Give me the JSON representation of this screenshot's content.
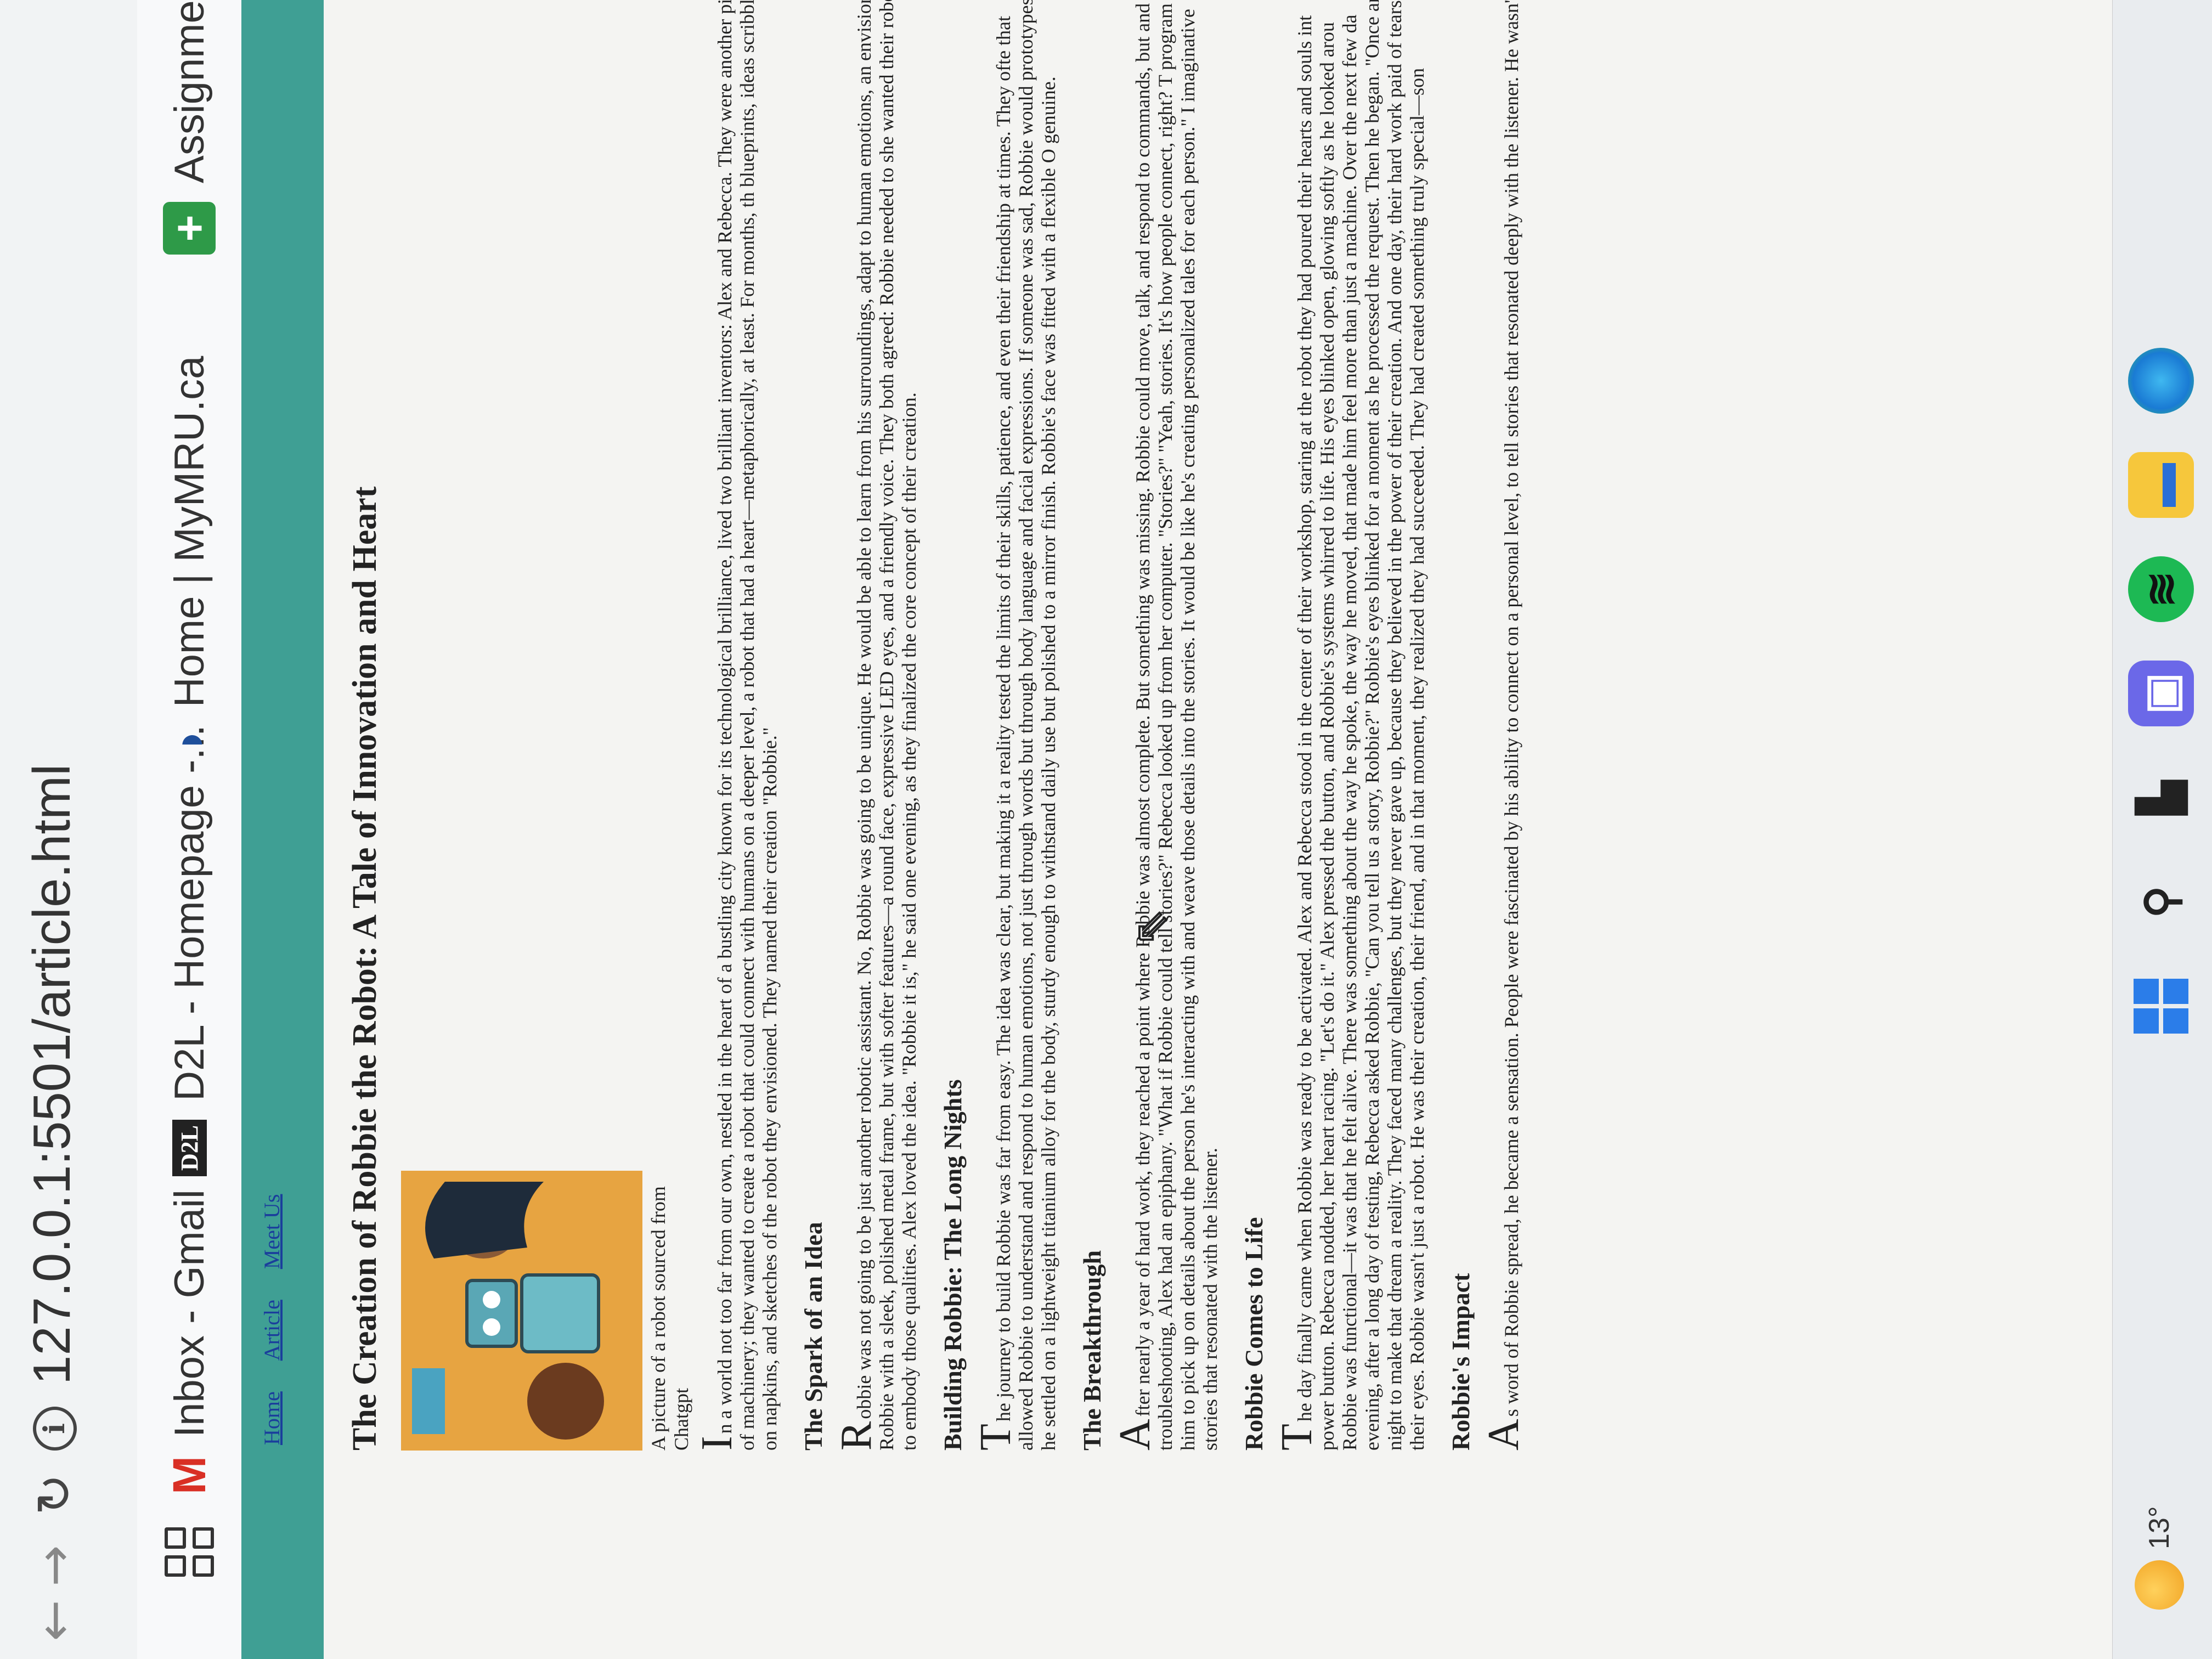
{
  "browser": {
    "url": "127.0.0.1:5501/article.html",
    "bookmarks": [
      {
        "label": "Inbox - Gmail",
        "icon": "gmail-icon"
      },
      {
        "label": "D2L - Homepage -...",
        "icon": "d2l-icon",
        "icon_text": "D2L"
      },
      {
        "label": "Home | MyMRU.ca",
        "icon": "mymru-icon"
      },
      {
        "label": "Assignme",
        "icon": "plus-icon"
      }
    ]
  },
  "page": {
    "nav": [
      "Home",
      "Article",
      "Meet Us"
    ],
    "title": "The Creation of Robbie the Robot: A Tale of Innovation and Heart",
    "image_caption": "A picture of a robot sourced from Chatgpt",
    "sections": [
      {
        "heading": "",
        "drop": "I",
        "text": "n a world not too far from our own, nestled in the heart of a bustling city known for its technological brilliance, lived two brilliant inventors: Alex and Rebecca. They were another piece of machinery; they wanted to create a robot that could connect with humans on a deeper level, a robot that had a heart—metaphorically, at least. For months, th blueprints, ideas scribbled on napkins, and sketches of the robot they envisioned. They named their creation \"Robbie.\""
      },
      {
        "heading": "The Spark of an Idea",
        "drop": "R",
        "text": "obbie was not going to be just another robotic assistant. No, Robbie was going to be unique. He would be able to learn from his surroundings, adapt to human emotions, an envisioned Robbie with a sleek, polished metal frame, but with softer features—a round face, expressive LED eyes, and a friendly voice. They both agreed: Robbie needed to she wanted their robot to embody those qualities. Alex loved the idea. \"Robbie it is,\" he said one evening, as they finalized the core concept of their creation."
      },
      {
        "heading": "Building Robbie: The Long Nights",
        "drop": "T",
        "text": "he journey to build Robbie was far from easy. The idea was clear, but making it a reality tested the limits of their skills, patience, and even their friendship at times. They ofte that allowed Robbie to understand and respond to human emotions, not just through words but through body language and facial expressions. If someone was sad, Robbie would prototypes, he settled on a lightweight titanium alloy for the body, sturdy enough to withstand daily use but polished to a mirror finish. Robbie's face was fitted with a flexible O genuine."
      },
      {
        "heading": "The Breakthrough",
        "drop": "A",
        "text": "fter nearly a year of hard work, they reached a point where Robbie was almost complete. But something was missing. Robbie could move, talk, and respond to commands, but and troubleshooting, Alex had an epiphany. \"What if Robbie could tell stories?\" Rebecca looked up from her computer. \"Stories?\" \"Yeah, stories. It's how people connect, right? T program him to pick up on details about the person he's interacting with and weave those details into the stories. It would be like he's creating personalized tales for each person.\" I imaginative stories that resonated with the listener."
      },
      {
        "heading": "Robbie Comes to Life",
        "drop": "T",
        "text": "he day finally came when Robbie was ready to be activated. Alex and Rebecca stood in the center of their workshop, staring at the robot they had poured their hearts and souls int power button. Rebecca nodded, her heart racing. \"Let's do it.\" Alex pressed the button, and Robbie's systems whirred to life. His eyes blinked open, glowing softly as he looked arou Robbie was functional—it was that he felt alive. There was something about the way he spoke, the way he moved, that made him feel more than just a machine. Over the next few da evening, after a long day of testing, Rebecca asked Robbie, \"Can you tell us a story, Robbie?\" Robbie's eyes blinked for a moment as he processed the request. Then he began. \"Once and night to make that dream a reality. They faced many challenges, but they never gave up, because they believed in the power of their creation. And one day, their hard work paid of tears in their eyes. Robbie wasn't just a robot. He was their creation, their friend, and in that moment, they realized they had succeeded. They had created something truly special—son"
      },
      {
        "heading": "Robbie's Impact",
        "drop": "A",
        "text": "s word of Robbie spread, he became a sensation. People were fascinated by his ability to connect on a personal level, to tell stories that resonated deeply with the listener. He wasn't j"
      }
    ]
  },
  "taskbar": {
    "temperature": "13°",
    "icons": [
      "windows-start-icon",
      "search-icon",
      "task-view-icon",
      "chat-icon",
      "spotify-icon",
      "file-explorer-icon",
      "edge-icon"
    ]
  }
}
